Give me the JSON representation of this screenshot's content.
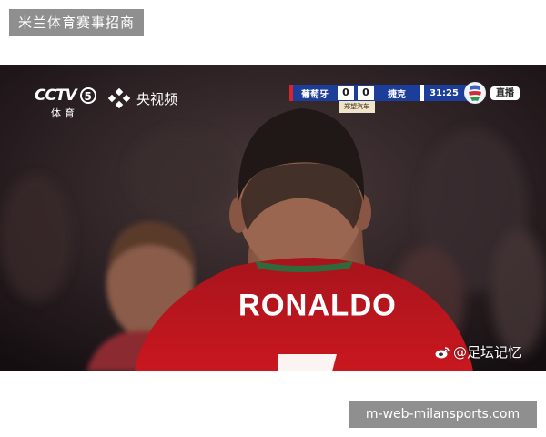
{
  "top_tag": {
    "text": "米兰体育赛事招商"
  },
  "bottom_tag": {
    "text": "m-web-milansports.com"
  },
  "broadcast": {
    "channel_logo": "CCTV",
    "channel_number": "5",
    "channel_sub": "体育",
    "app_logo_icon": "yangshipin-logo-icon",
    "app_name": "央视频",
    "live_label": "直播",
    "sponsor": "郑望汽车"
  },
  "scoreboard": {
    "team_home": "葡萄牙",
    "score_home": "0",
    "score_away": "0",
    "team_away": "捷克",
    "clock": "31:25",
    "accent_home": "#d8242a",
    "bar_color": "#1c3d9a"
  },
  "jersey": {
    "name": "RONALDO",
    "color": "#c4161f"
  },
  "watermark": {
    "icon": "weibo-icon",
    "text": "@足坛记忆"
  }
}
